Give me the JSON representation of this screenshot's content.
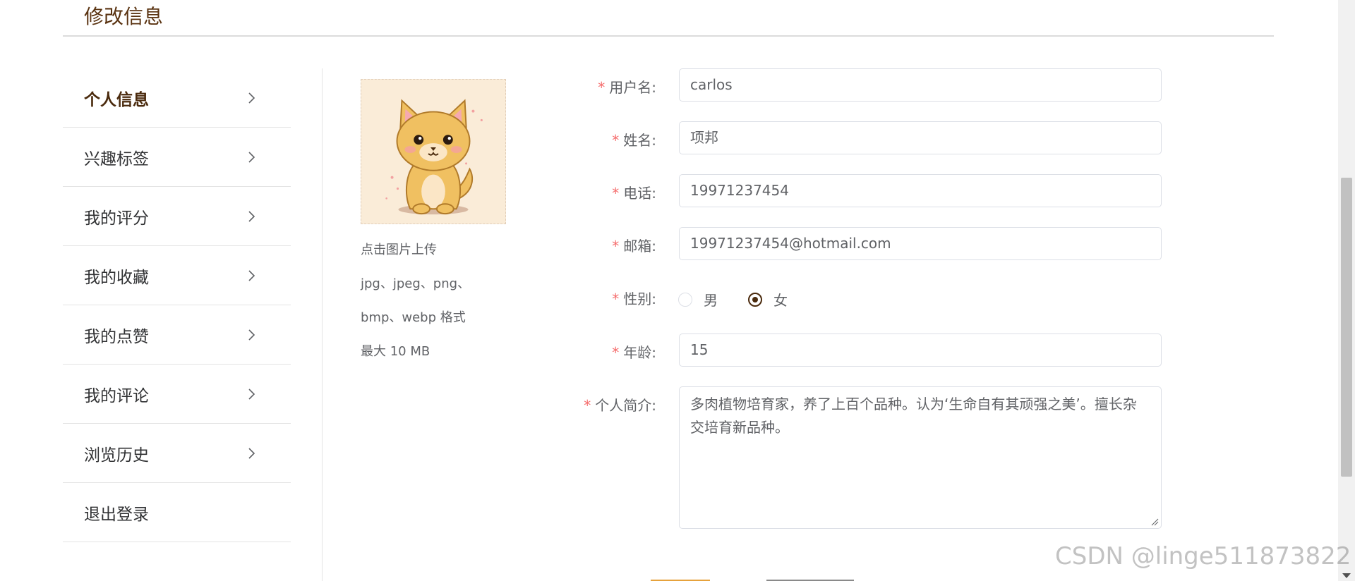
{
  "page": {
    "title": "修改信息"
  },
  "sidebar": {
    "items": [
      {
        "label": "个人信息",
        "active": true
      },
      {
        "label": "兴趣标签"
      },
      {
        "label": "我的评分"
      },
      {
        "label": "我的收藏"
      },
      {
        "label": "我的点赞"
      },
      {
        "label": "我的评论"
      },
      {
        "label": "浏览历史"
      },
      {
        "label": "退出登录"
      }
    ]
  },
  "avatar": {
    "hint_lines": [
      "点击图片上传",
      "jpg、jpeg、png、",
      "bmp、webp 格式",
      "最大 10 MB"
    ]
  },
  "form": {
    "required_mark": "*",
    "username": {
      "label": "用户名:",
      "value": "carlos"
    },
    "name": {
      "label": "姓名:",
      "value": "项邦"
    },
    "phone": {
      "label": "电话:",
      "value": "19971237454"
    },
    "email": {
      "label": "邮箱:",
      "value": "19971237454@hotmail.com"
    },
    "gender": {
      "label": "性别:",
      "options": [
        "男",
        "女"
      ],
      "selected": "女"
    },
    "age": {
      "label": "年龄:",
      "value": "15"
    },
    "bio": {
      "label": "个人简介:",
      "value": "多肉植物培育家，养了上百个品种。认为‘生命自有其顽强之美’。擅长杂交培育新品种。"
    }
  },
  "watermark": "CSDN @linge511873822",
  "colors": {
    "accent": "#4a2a0d",
    "title": "#5a3311",
    "required": "#f56c6c"
  }
}
